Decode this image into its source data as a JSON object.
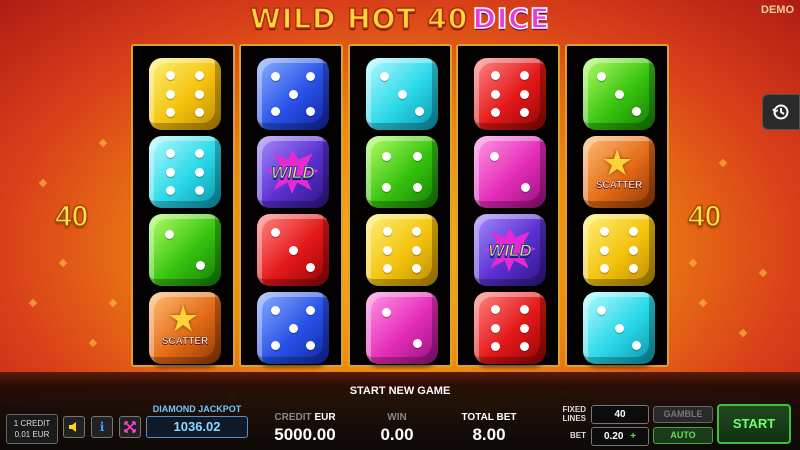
{
  "game": {
    "title_main": "WILD HOT 40",
    "title_accent": "DICE",
    "mode_badge": "DEMO",
    "lines_left": "40",
    "lines_right": "40",
    "history_icon": "history-icon"
  },
  "reels": [
    [
      {
        "type": "die",
        "color": "yellow",
        "pips": 6
      },
      {
        "type": "die",
        "color": "cyan",
        "pips": 6
      },
      {
        "type": "die",
        "color": "green",
        "pips": 2
      },
      {
        "type": "scatter",
        "label": "SCATTER"
      }
    ],
    [
      {
        "type": "die",
        "color": "blue",
        "pips": 5
      },
      {
        "type": "wild",
        "label": "WILD"
      },
      {
        "type": "die",
        "color": "red",
        "pips": 3
      },
      {
        "type": "die",
        "color": "blue",
        "pips": 5
      }
    ],
    [
      {
        "type": "die",
        "color": "cyan",
        "pips": 3
      },
      {
        "type": "die",
        "color": "green",
        "pips": 4
      },
      {
        "type": "die",
        "color": "yellow",
        "pips": 6
      },
      {
        "type": "die",
        "color": "pink",
        "pips": 2
      }
    ],
    [
      {
        "type": "die",
        "color": "red",
        "pips": 6
      },
      {
        "type": "die",
        "color": "pink",
        "pips": 2
      },
      {
        "type": "wild",
        "label": "WILD"
      },
      {
        "type": "die",
        "color": "red",
        "pips": 6
      }
    ],
    [
      {
        "type": "die",
        "color": "green",
        "pips": 3
      },
      {
        "type": "scatter",
        "label": "SCATTER"
      },
      {
        "type": "die",
        "color": "yellow",
        "pips": 6
      },
      {
        "type": "die",
        "color": "cyan",
        "pips": 3
      }
    ]
  ],
  "bottom_bar": {
    "status_message": "START NEW GAME",
    "credit_line1": "1 CREDIT",
    "credit_line2": "0.01 EUR",
    "sound_icon": "speaker-icon",
    "info_icon": "info-icon",
    "fullscreen_icon": "fullscreen-icon",
    "jackpot_label": "DIAMOND JACKPOT",
    "jackpot_value": "1036.02",
    "credit_label": "CREDIT",
    "credit_currency": "EUR",
    "credit_value": "5000.00",
    "win_label": "WIN",
    "win_value": "0.00",
    "total_bet_label": "TOTAL BET",
    "total_bet_value": "8.00",
    "fixed_lines_label_1": "FIXED",
    "fixed_lines_label_2": "LINES",
    "fixed_lines_value": "40",
    "bet_label": "BET",
    "bet_value": "0.20",
    "bet_plus": "+",
    "gamble_label": "GAMBLE",
    "auto_label": "AUTO",
    "start_label": "START"
  }
}
